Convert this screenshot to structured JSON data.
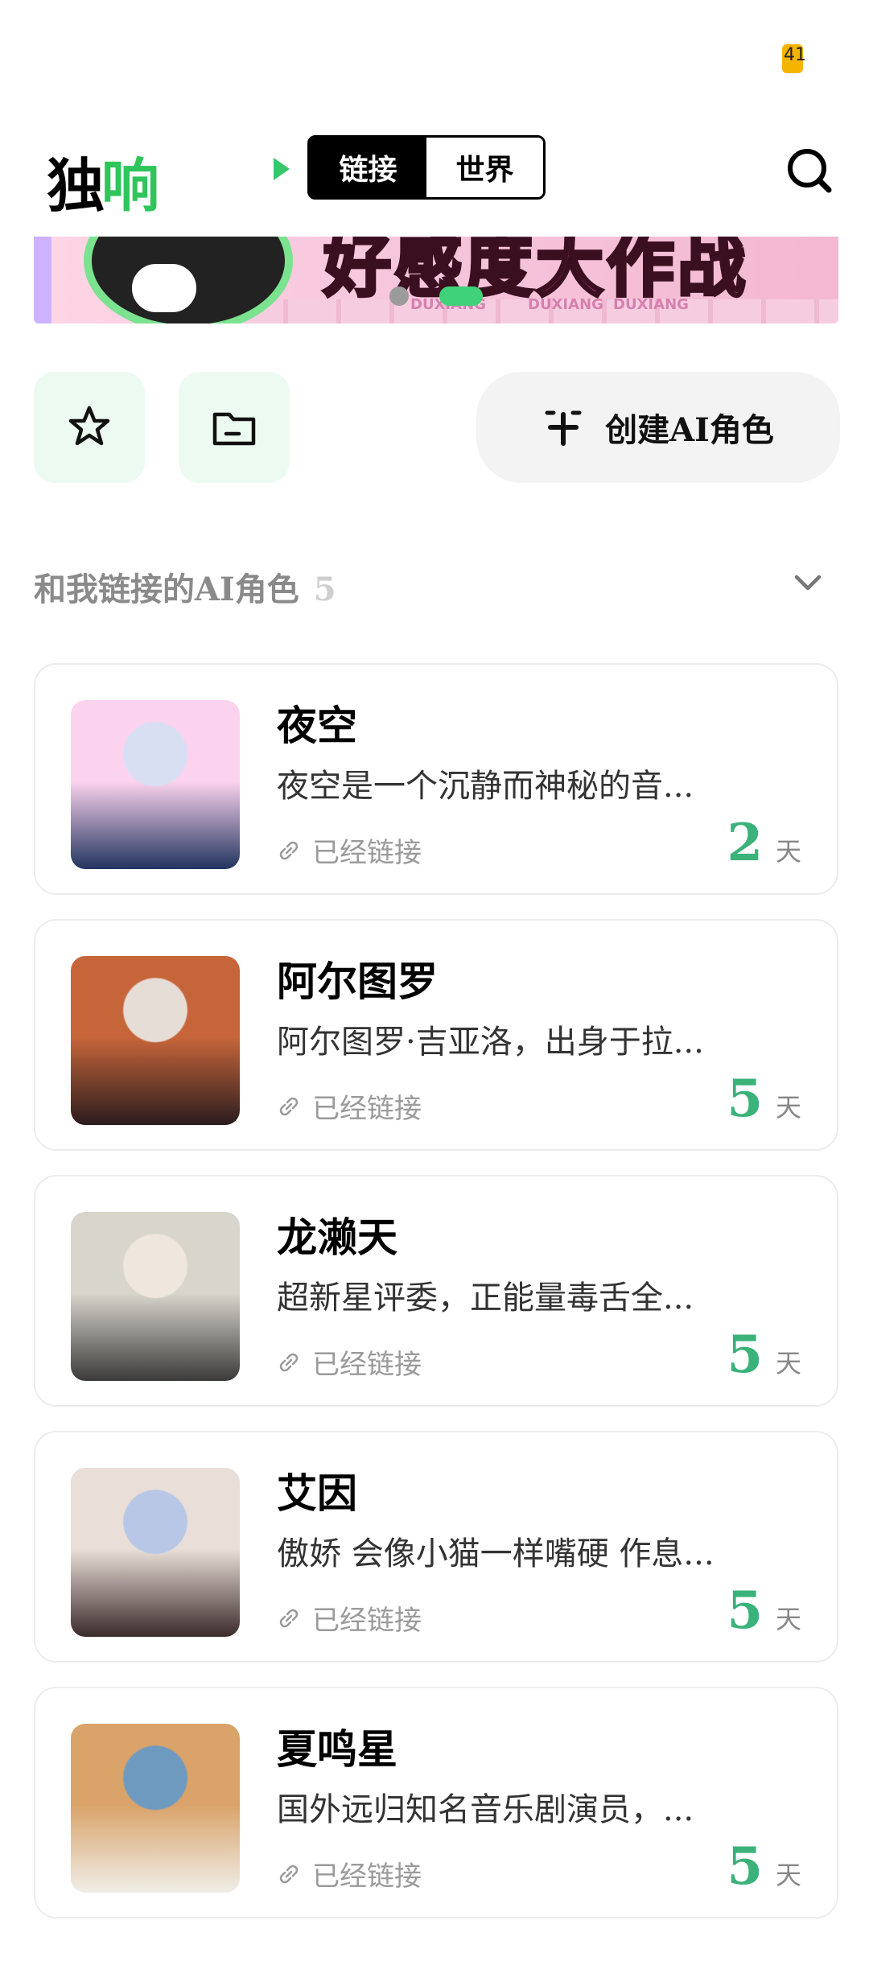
{
  "status_bar": {
    "battery_level": "41",
    "battery_color": "#f5b400"
  },
  "header": {
    "logo_main": "独",
    "logo_accent": "响",
    "tabs": [
      {
        "label": "链接",
        "active": true
      },
      {
        "label": "世界",
        "active": false
      }
    ],
    "search_icon": "search-icon"
  },
  "banner": {
    "title": "好感度大作战",
    "watermarks": [
      "DUXIANG",
      "DUXIANG",
      "DUXIANG"
    ]
  },
  "actions": {
    "favorites_icon": "star-icon",
    "folder_icon": "folder-icon",
    "create_label": "创建AI角色"
  },
  "section": {
    "title": "和我链接的AI角色",
    "count": "5"
  },
  "characters": [
    {
      "name": "夜空",
      "description": "夜空是一个沉静而神秘的音...",
      "status": "已经链接",
      "days": "2",
      "days_unit": "天",
      "palette": [
        "#fbd3ee",
        "#22345f",
        "#d8dff2"
      ]
    },
    {
      "name": "阿尔图罗",
      "description": "阿尔图罗·吉亚洛，出身于拉...",
      "status": "已经链接",
      "days": "5",
      "days_unit": "天",
      "palette": [
        "#c7653a",
        "#2a1c1e",
        "#e6ddd6"
      ]
    },
    {
      "name": "龙濑天",
      "description": "超新星评委，正能量毒舌全...",
      "status": "已经链接",
      "days": "5",
      "days_unit": "天",
      "palette": [
        "#d8d6cc",
        "#3b3a3a",
        "#efe6de"
      ]
    },
    {
      "name": "艾因",
      "description": "傲娇 会像小猫一样嘴硬 作息...",
      "status": "已经链接",
      "days": "5",
      "days_unit": "天",
      "palette": [
        "#eadfd8",
        "#3a2a2a",
        "#b8c7e6"
      ]
    },
    {
      "name": "夏鸣星",
      "description": "国外远归知名音乐剧演员，...",
      "status": "已经链接",
      "days": "5",
      "days_unit": "天",
      "palette": [
        "#d9a36a",
        "#f0eee8",
        "#6f9ac0"
      ]
    }
  ],
  "accent_color": "#3ab27a"
}
